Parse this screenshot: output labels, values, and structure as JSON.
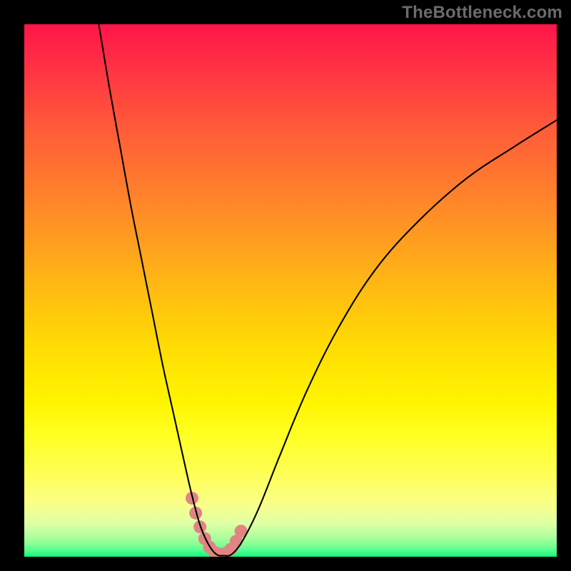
{
  "watermark": "TheBottleneck.com",
  "colors": {
    "curve": "#000000",
    "markers": "#e08484",
    "background_border": "#000000"
  },
  "chart_data": {
    "type": "line",
    "title": "",
    "xlabel": "",
    "ylabel": "",
    "xlim": [
      0,
      100
    ],
    "ylim": [
      0,
      100
    ],
    "grid": false,
    "legend": false,
    "description": "Bottleneck curve: a sharp V-shaped dip reaching ~0 near x≈35, high on both sides, on a red-to-green vertical gradient background.",
    "series": [
      {
        "name": "bottleneck-curve",
        "x": [
          14,
          16,
          18,
          20,
          22,
          24,
          26,
          28,
          30,
          31.5,
          33,
          34.5,
          36,
          37.5,
          39,
          41,
          44,
          48,
          53,
          59,
          66,
          74,
          83,
          92,
          100
        ],
        "y": [
          100,
          88,
          77,
          66,
          56,
          46,
          36,
          27,
          18,
          11.5,
          6,
          2.5,
          0.5,
          0.2,
          0.5,
          3,
          9,
          19,
          31,
          43,
          54,
          63,
          71,
          77,
          82
        ]
      }
    ],
    "markers": {
      "name": "highlight-cluster",
      "x": [
        31.5,
        32.2,
        33.0,
        33.9,
        34.8,
        35.8,
        36.8,
        37.8,
        38.8,
        39.8,
        40.7
      ],
      "y": [
        11.0,
        8.2,
        5.6,
        3.4,
        1.8,
        0.8,
        0.5,
        0.6,
        1.4,
        2.9,
        4.8
      ],
      "radius_px": 9
    }
  }
}
